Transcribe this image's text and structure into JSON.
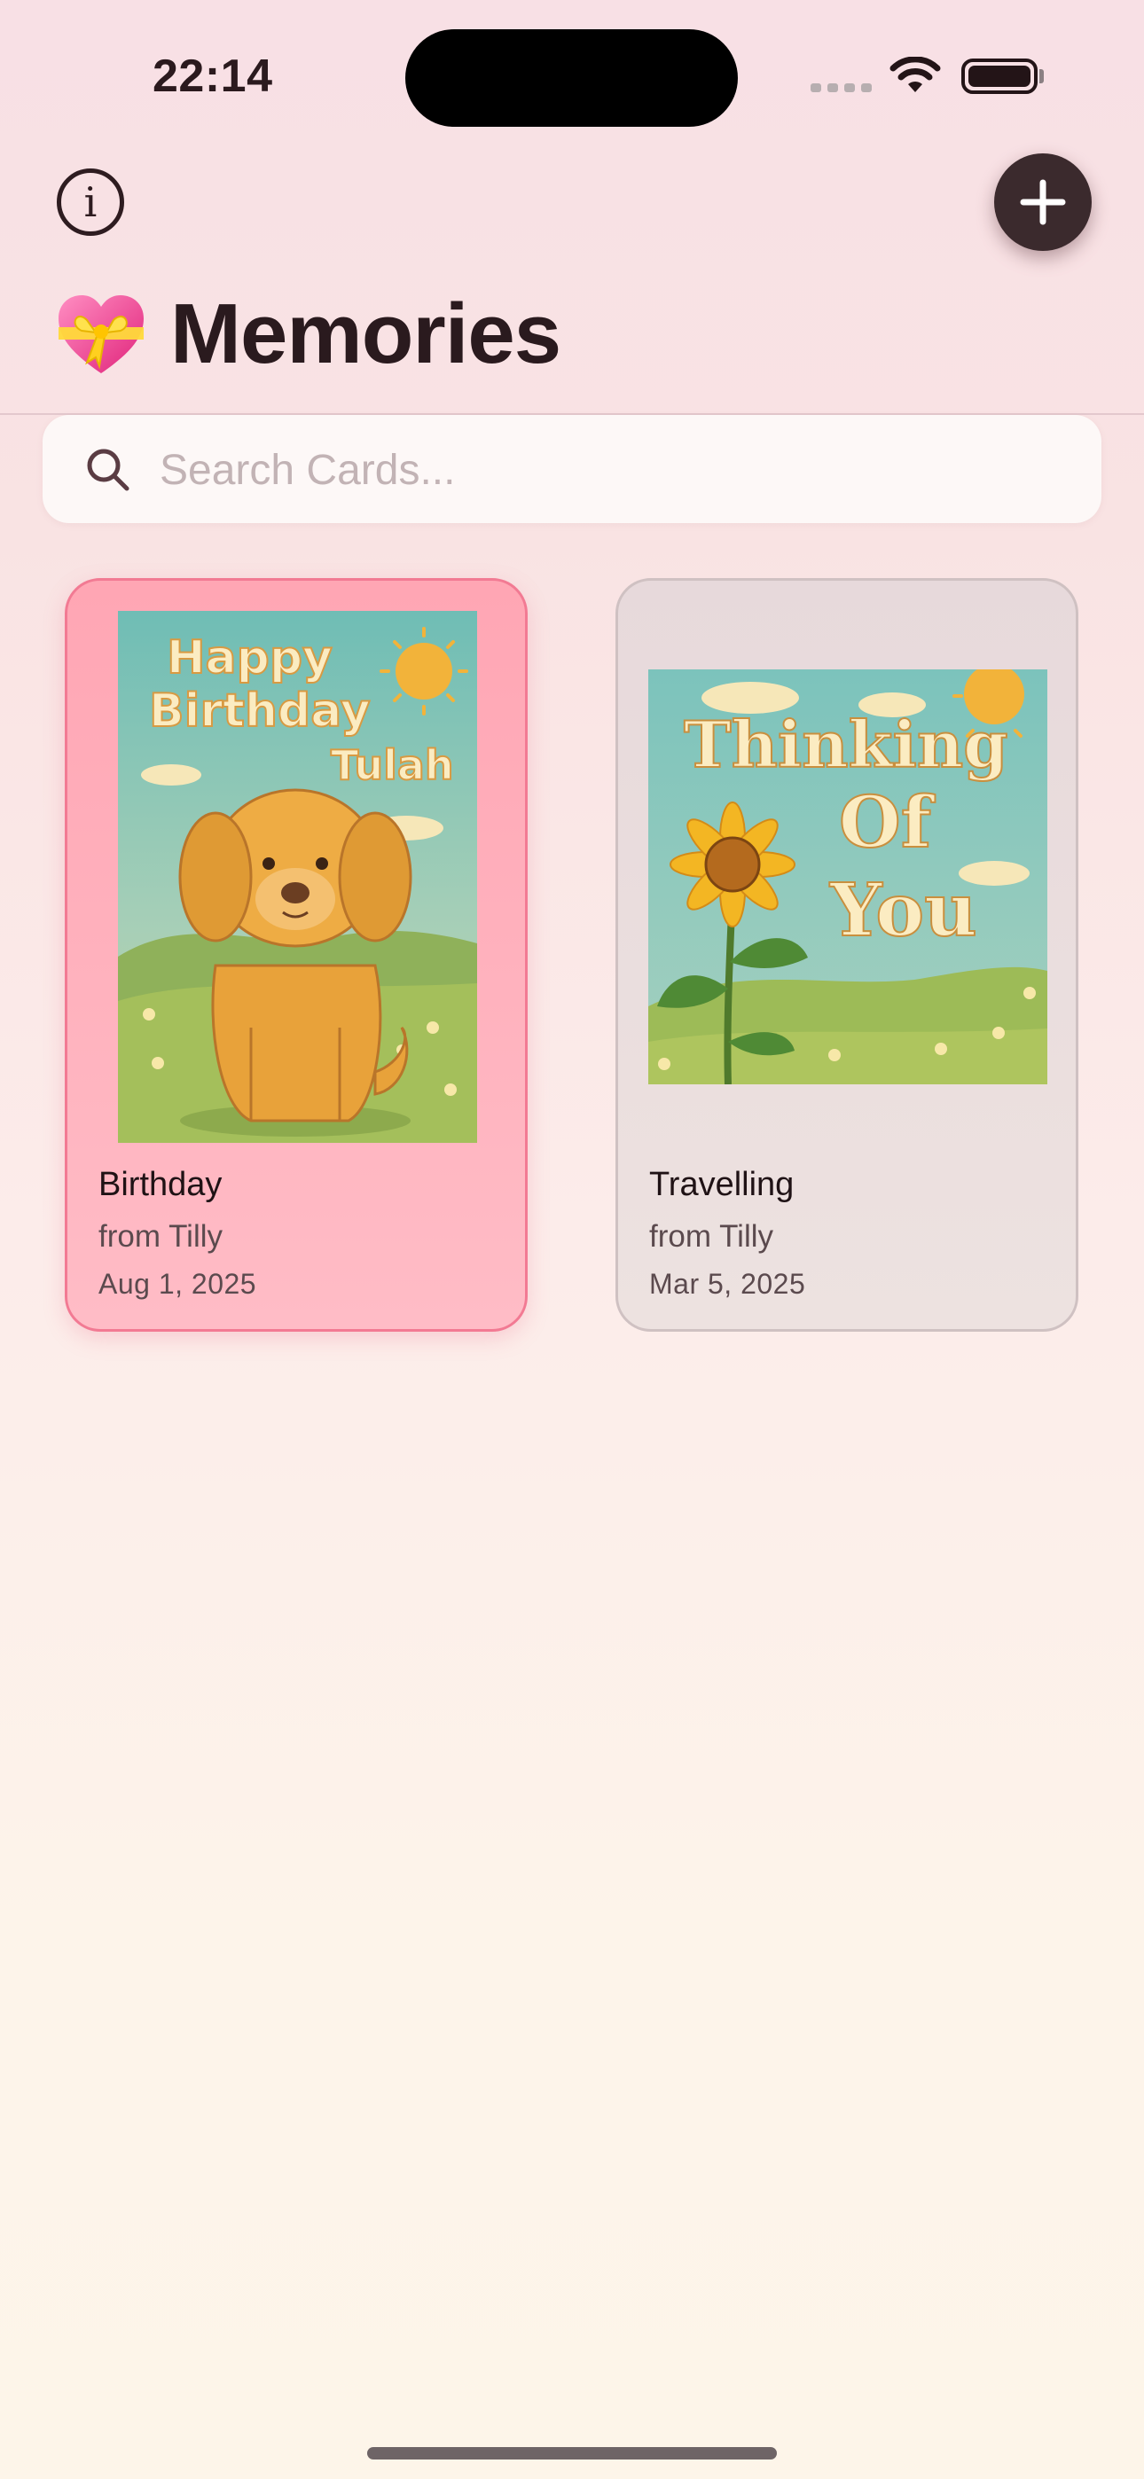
{
  "status_bar": {
    "time": "22:14"
  },
  "header": {
    "info_icon": "info-circle-icon",
    "add_icon": "plus-icon",
    "title_emoji": "💝",
    "title": "Memories"
  },
  "search": {
    "placeholder": "Search Cards...",
    "value": ""
  },
  "cards": [
    {
      "title": "Birthday",
      "from": "from Tilly",
      "date": "Aug 1, 2025",
      "selected": true,
      "image_text": [
        "Happy",
        "Birthday",
        "Tulah"
      ]
    },
    {
      "title": "Travelling",
      "from": "from Tilly",
      "date": "Mar 5, 2025",
      "selected": false,
      "image_text": [
        "Thinking",
        "Of",
        "You"
      ]
    }
  ],
  "colors": {
    "selected_card_bg": "#ffb3bf",
    "selected_card_border": "#f27a93",
    "card_bg": "#ebe0df",
    "add_button": "#3b2a2d"
  }
}
